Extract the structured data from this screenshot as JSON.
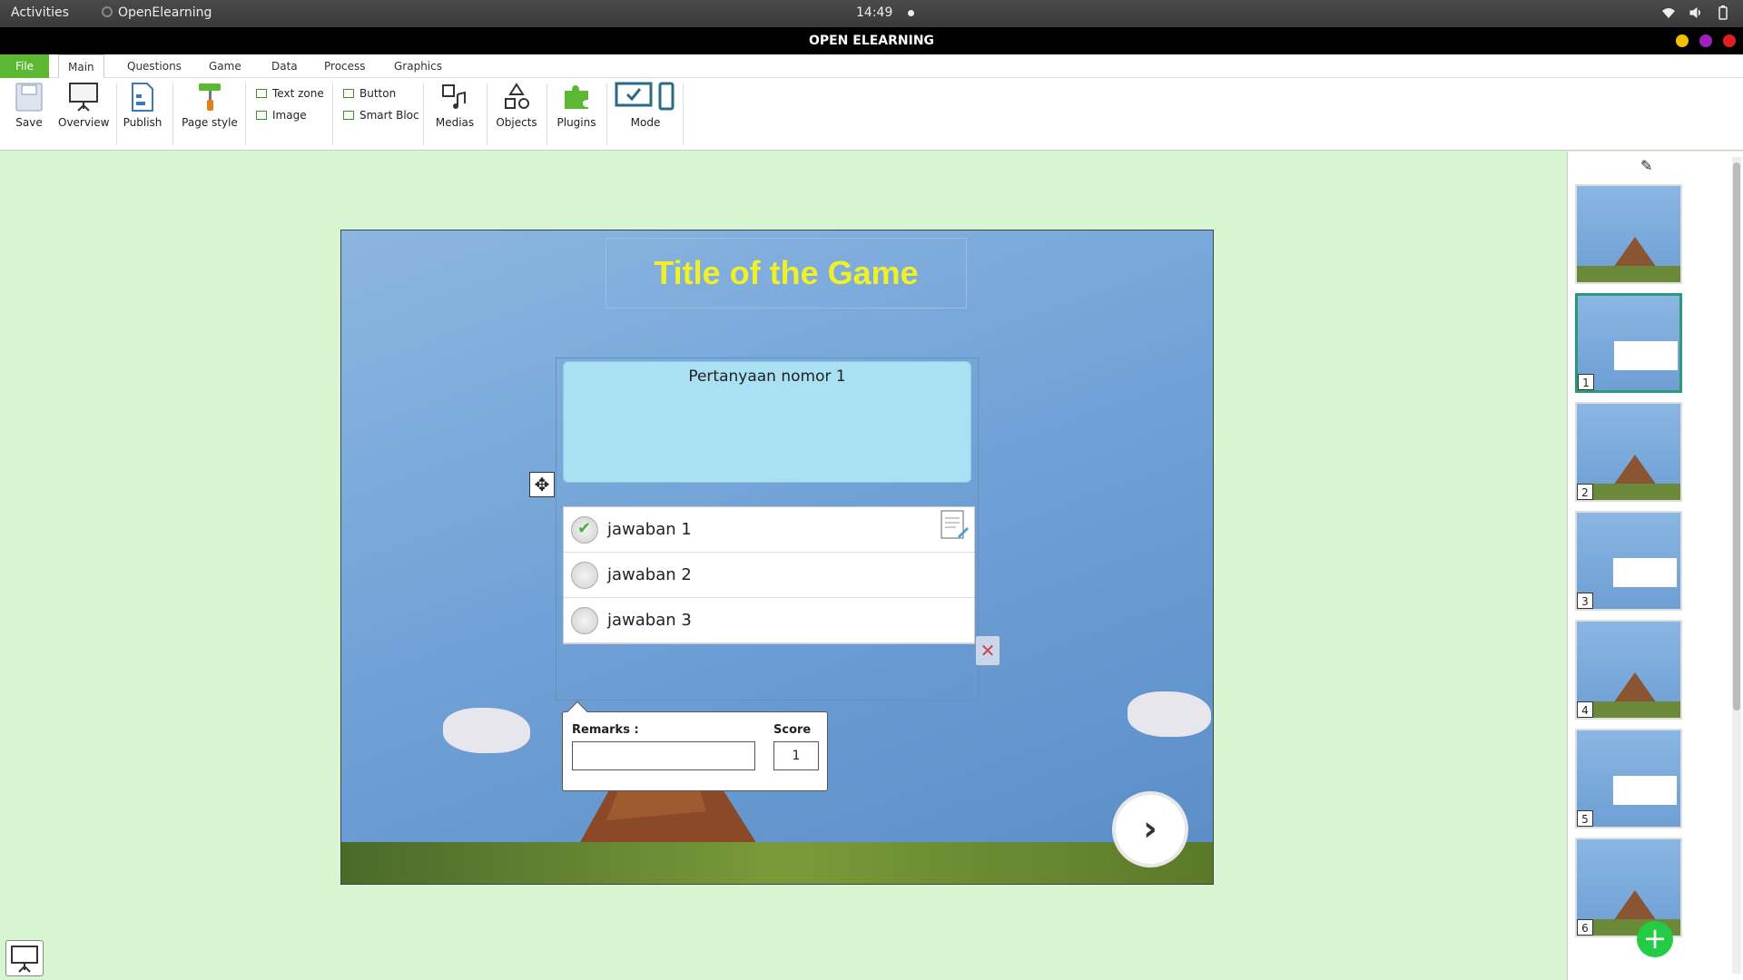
{
  "system": {
    "activities": "Activities",
    "app_name": "OpenElearning",
    "clock": "14:49"
  },
  "window": {
    "title": "OPEN ELEARNING"
  },
  "menu": {
    "tabs": [
      {
        "label": "File"
      },
      {
        "label": "Main"
      },
      {
        "label": "Questions"
      },
      {
        "label": "Game"
      },
      {
        "label": "Data"
      },
      {
        "label": "Process"
      },
      {
        "label": "Graphics"
      }
    ]
  },
  "ribbon": {
    "save": "Save",
    "overview": "Overview",
    "publish": "Publish",
    "page_style": "Page style",
    "text_zone": "Text zone",
    "image": "Image",
    "button": "Button",
    "smart_bloc": "Smart Bloc",
    "medias": "Medias",
    "objects": "Objects",
    "plugins": "Plugins",
    "mode": "Mode"
  },
  "stage": {
    "game_title": "Title of the Game",
    "question": "Pertanyaan nomor 1",
    "answers": [
      {
        "label": "jawaban 1",
        "checked": true
      },
      {
        "label": "jawaban 2",
        "checked": false
      },
      {
        "label": "jawaban 3",
        "checked": false
      }
    ],
    "remarks_label": "Remarks :",
    "score_label": "Score",
    "score_value": "1",
    "title_color": "#f0f028"
  },
  "slides": {
    "numbers": [
      "1",
      "2",
      "3",
      "4",
      "5",
      "6"
    ]
  },
  "colors": {
    "accent": "#5cb832",
    "workspace": "#d6f5d0",
    "add_button": "#22cc44"
  }
}
